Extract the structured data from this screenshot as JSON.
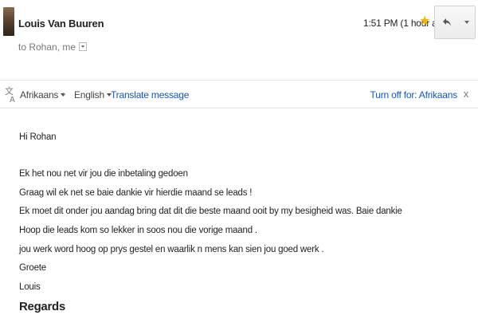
{
  "email": {
    "sender_name": "Louis Van Buuren",
    "recipients": "to Rohan, me",
    "time": "1:51 PM (1 hour ago)",
    "icons": {
      "avatar": "avatar",
      "star": "star-icon",
      "reply": "reply-icon",
      "more": "chevron-down-icon"
    }
  },
  "translation_bar": {
    "source_language": "Afrikaans",
    "target_language": "English",
    "translate_link": "Translate message",
    "turn_off_link": "Turn off for: Afrikaans",
    "close": "x",
    "arrow": "›"
  },
  "message": {
    "greeting": "Hi Rohan",
    "lines": [
      "Ek het nou net vir jou die inbetaling gedoen",
      "Graag wil ek net se baie dankie vir hierdie maand se leads !",
      "Ek moet dit onder jou aandag bring dat dit die beste maand ooit by my besigheid was. Baie dankie",
      "Hoop die leads kom so lekker in soos nou die vorige maand .",
      "jou werk word hoog op prys gestel en waarlik n mens kan sien jou goed werk .",
      "Groete",
      "Louis"
    ],
    "signature": "Regards"
  },
  "colors": {
    "link": "#1155cc",
    "star": "#f4b400"
  }
}
